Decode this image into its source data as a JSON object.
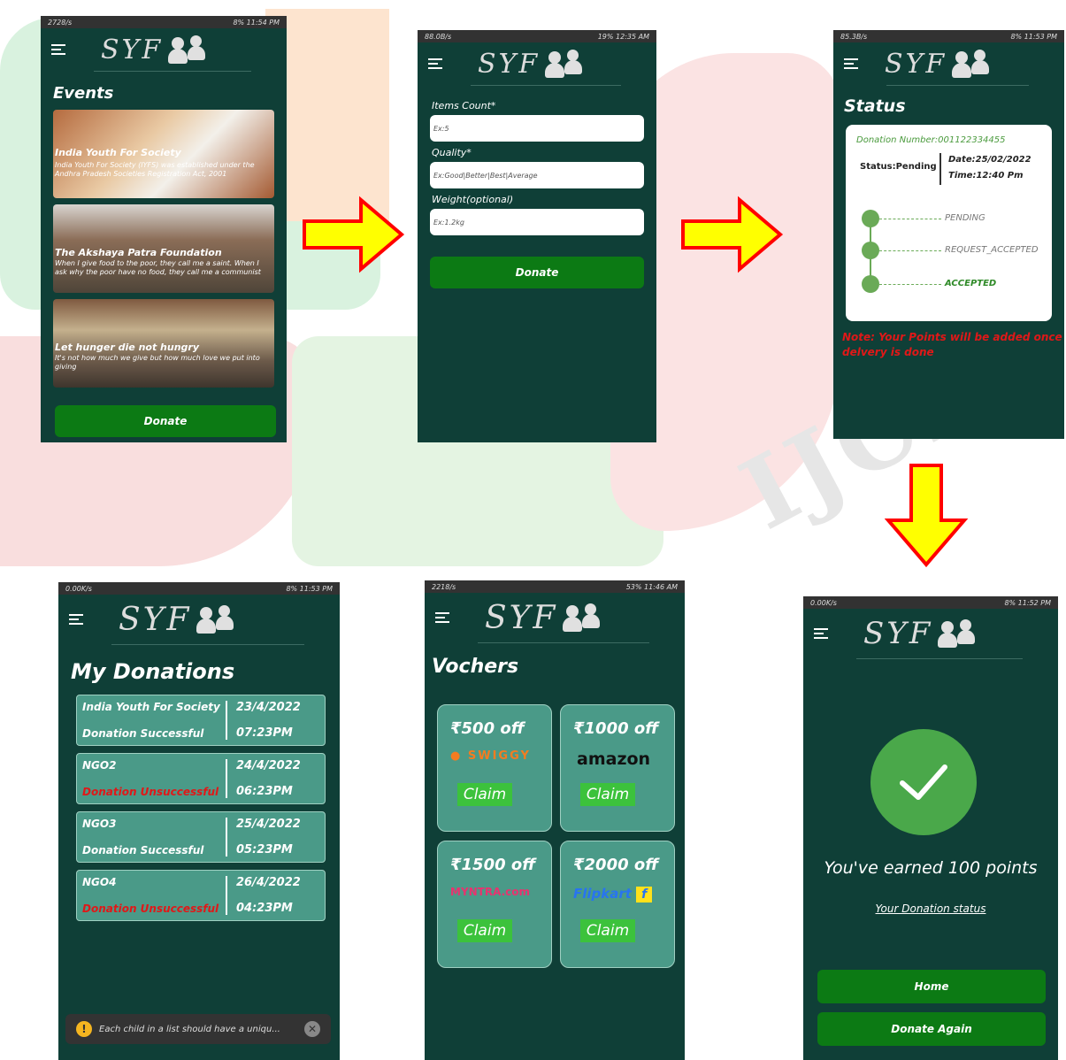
{
  "colors": {
    "phone_bg": "#0f3f37",
    "green_button": "#0c7a14",
    "card_teal": "#4a9a88",
    "status_green": "#6aaa57",
    "error_red": "#e01818",
    "arrow_yellow": "#ffff00",
    "arrow_red": "#ff0000"
  },
  "logo": {
    "text": "SYF",
    "icon": "people-icon"
  },
  "events_screen": {
    "status": {
      "left": "2728/s",
      "right": "8% 11:54 PM"
    },
    "title": "Events",
    "events": [
      {
        "title": "India Youth For Society",
        "desc": "India Youth For Society (IYFS) was established under the Andhra Pradesh Societies Registration Act, 2001"
      },
      {
        "title": "The Akshaya Patra Foundation",
        "desc": "When I give food to the poor, they call me a saint. When I ask why the poor have no food, they call me a communist"
      },
      {
        "title": "Let hunger die not hungry",
        "desc": "It's not how much we give but how much love we put into giving"
      }
    ],
    "donate_label": "Donate"
  },
  "form_screen": {
    "status": {
      "left": "88.0B/s",
      "right": "19% 12:35 AM"
    },
    "fields": [
      {
        "label": "Items Count*",
        "placeholder": "Ex:5"
      },
      {
        "label": "Quality*",
        "placeholder": "Ex:Good|Better|Best|Average"
      },
      {
        "label": "Weight(optional)",
        "placeholder": "Ex:1.2kg"
      }
    ],
    "donate_label": "Donate"
  },
  "status_screen": {
    "status": {
      "left": "85.3B/s",
      "right": "8% 11:53 PM"
    },
    "title": "Status",
    "donation_number": "Donation Number:001122334455",
    "status_text": "Status:Pending",
    "date": "Date:25/02/2022",
    "time": "Time:12:40 Pm",
    "timeline": [
      "PENDING",
      "REQUEST_ACCEPTED",
      "ACCEPTED"
    ],
    "note": "Note: Your Points will be added once delvery is done"
  },
  "donations_screen": {
    "status": {
      "left": "0.00K/s",
      "right": "8% 11:53 PM"
    },
    "title": "My Donations",
    "items": [
      {
        "name": "India Youth For Society",
        "result": "Donation Successful",
        "date": "23/4/2022",
        "time": "07:23PM",
        "success": true
      },
      {
        "name": "NGO2",
        "result": "Donation Unsuccessful",
        "date": "24/4/2022",
        "time": "06:23PM",
        "success": false
      },
      {
        "name": "NGO3",
        "result": "Donation Successful",
        "date": "25/4/2022",
        "time": "05:23PM",
        "success": true
      },
      {
        "name": "NGO4",
        "result": "Donation Unsuccessful",
        "date": "26/4/2022",
        "time": "04:23PM",
        "success": false
      }
    ],
    "toast": "Each child in a list should have a uniqu..."
  },
  "vouchers_screen": {
    "status": {
      "left": "2218/s",
      "right": "53% 11:46 AM"
    },
    "title": "Vochers",
    "vouchers": [
      {
        "amount": "₹500 off",
        "brand": "SWIGGY",
        "claim": "Claim"
      },
      {
        "amount": "₹1000 off",
        "brand": "amazon",
        "claim": "Claim"
      },
      {
        "amount": "₹1500 off",
        "brand": "MYNTRA.com",
        "claim": "Claim"
      },
      {
        "amount": "₹2000 off",
        "brand": "Flipkart",
        "claim": "Claim"
      }
    ]
  },
  "points_screen": {
    "status": {
      "left": "0.00K/s",
      "right": "8% 11:52 PM"
    },
    "earned": "You've earned 100 points",
    "status_link": "Your Donation status",
    "home_label": "Home",
    "donate_again_label": "Donate Again"
  }
}
